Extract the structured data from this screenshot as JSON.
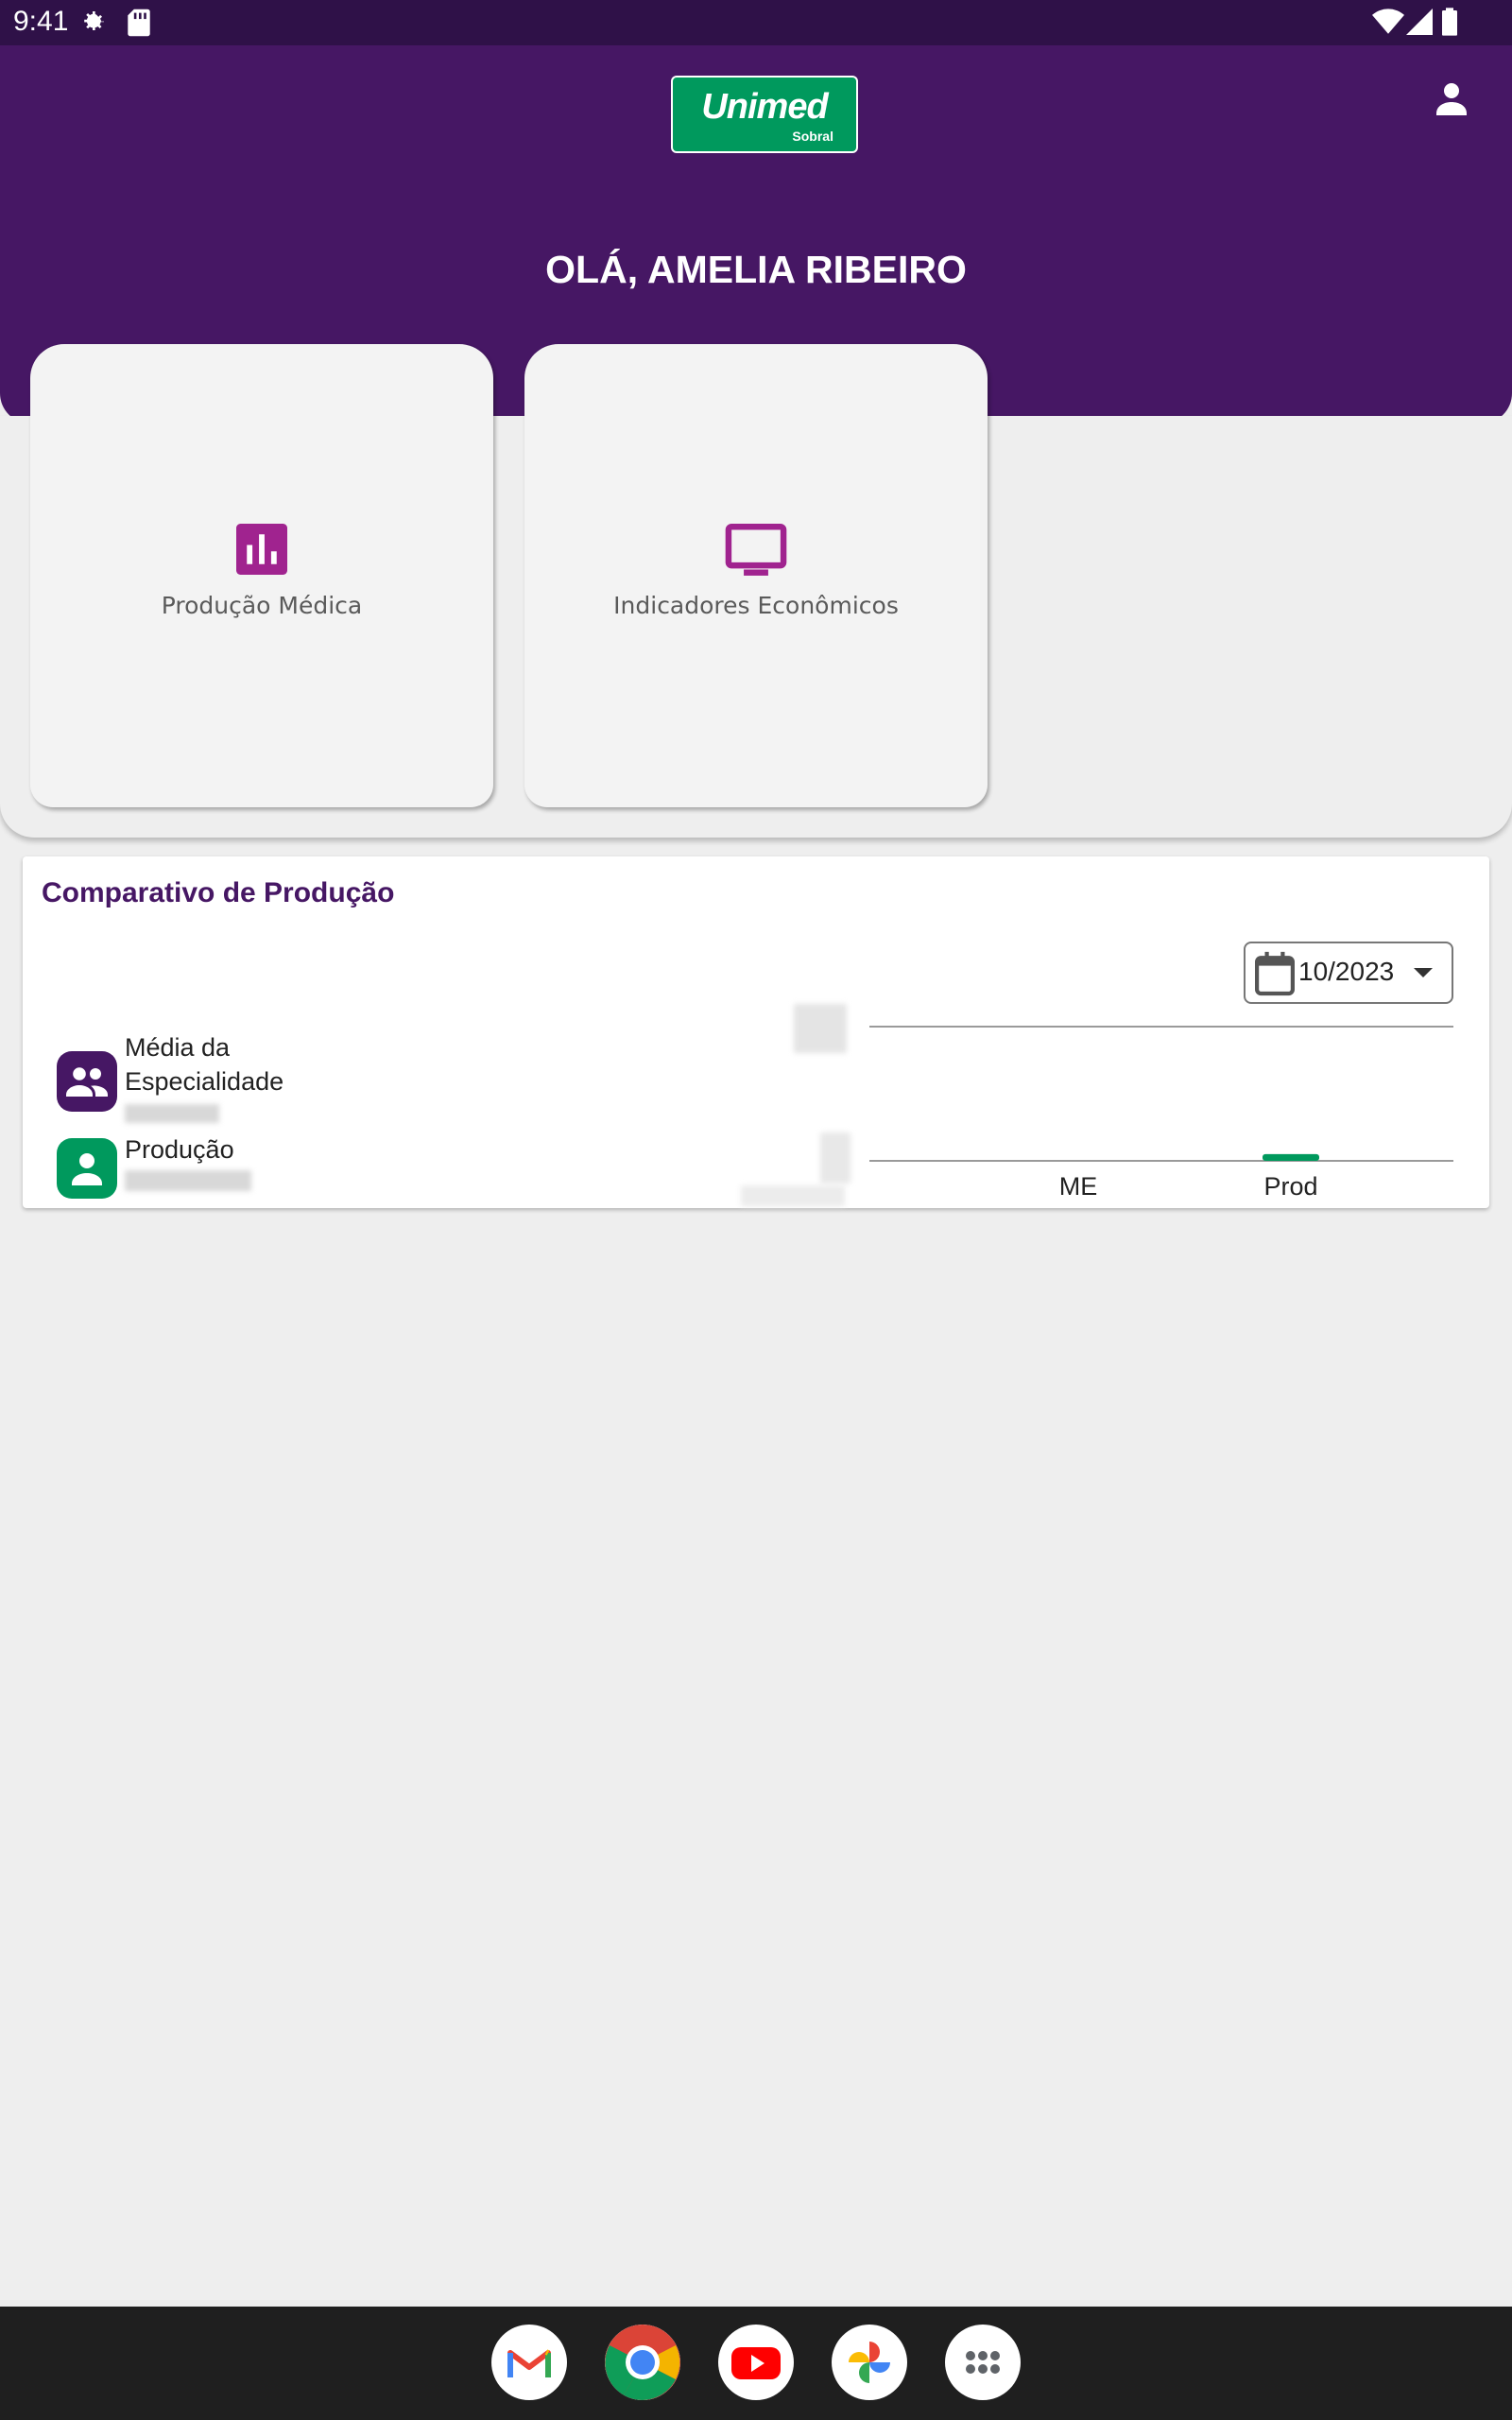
{
  "status_bar": {
    "time": "9:41",
    "icons": [
      "settings-icon",
      "sd-card-icon",
      "wifi-icon",
      "signal-icon",
      "battery-icon"
    ]
  },
  "header": {
    "logo_main": "Unimed",
    "logo_sub": "Sobral",
    "greeting": "OLÁ, AMELIA RIBEIRO",
    "profile_icon": "person-icon"
  },
  "menu_cards": [
    {
      "label": "Produção Médica",
      "icon": "bar-chart-icon",
      "color": "#a0238f"
    },
    {
      "label": "Indicadores Econômicos",
      "icon": "monitor-icon",
      "color": "#a0238f"
    }
  ],
  "comparison": {
    "title": "Comparativo de Produção",
    "date_value": "10/2023",
    "legend": [
      {
        "label_line1": "Média da",
        "label_line2": "Especialidade",
        "icon": "group-icon",
        "color": "#461764"
      },
      {
        "label_line1": "Produção",
        "label_line2": "",
        "icon": "person-icon",
        "color": "#00995d"
      }
    ]
  },
  "chart_data": {
    "type": "bar",
    "categories": [
      "ME",
      "Prod"
    ],
    "series": [
      {
        "values": [
          0,
          0.05
        ],
        "colors": [
          "#461764",
          "#00995d"
        ]
      }
    ],
    "ylim": [
      0,
      1
    ],
    "grid": true
  },
  "dock": {
    "apps": [
      "gmail-icon",
      "chrome-icon",
      "youtube-icon",
      "photos-icon",
      "app-drawer-icon"
    ]
  },
  "colors": {
    "primary": "#461764",
    "accent": "#00995d",
    "menu_icon": "#a0238f"
  }
}
